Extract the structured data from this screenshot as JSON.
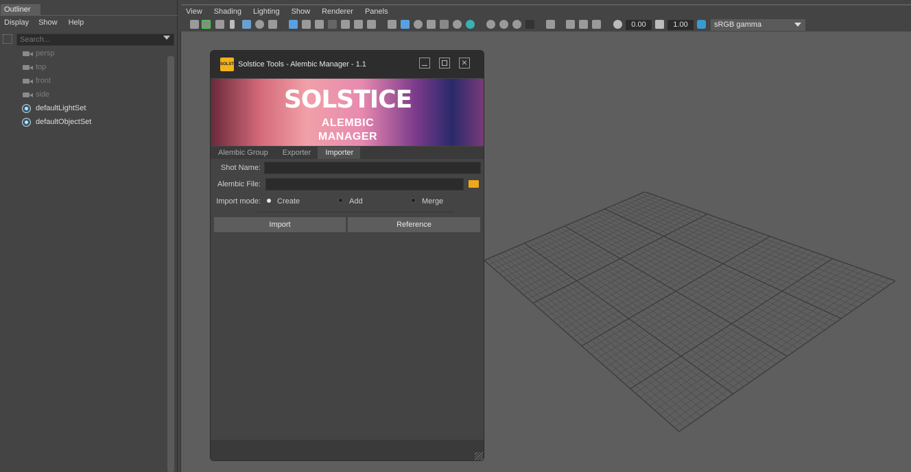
{
  "outliner": {
    "tab_label": "Outliner",
    "menu": [
      "Display",
      "Show",
      "Help"
    ],
    "search_placeholder": "Search...",
    "items": [
      {
        "label": "persp",
        "icon": "camera-icon"
      },
      {
        "label": "top",
        "icon": "camera-icon"
      },
      {
        "label": "front",
        "icon": "camera-icon"
      },
      {
        "label": "side",
        "icon": "camera-icon"
      },
      {
        "label": "defaultLightSet",
        "icon": "set-icon"
      },
      {
        "label": "defaultObjectSet",
        "icon": "set-icon"
      }
    ]
  },
  "viewport": {
    "menu": [
      "View",
      "Shading",
      "Lighting",
      "Show",
      "Renderer",
      "Panels"
    ],
    "exposure": "0.00",
    "gamma": "1.00",
    "color_space": "sRGB gamma"
  },
  "dialog": {
    "title": "Solstice Tools - Alembic Manager - 1.1",
    "logo_text": "SOLSTICE",
    "banner_title": "SOLSTICE",
    "banner_sub1": "ALEMBIC",
    "banner_sub2": "MANAGER",
    "tabs": [
      "Alembic Group",
      "Exporter",
      "Importer"
    ],
    "active_tab": "Importer",
    "shot_name_label": "Shot Name:",
    "shot_name_value": "",
    "alembic_file_label": "Alembic File:",
    "alembic_file_value": "",
    "import_mode_label": "Import mode:",
    "modes": [
      "Create",
      "Add",
      "Merge"
    ],
    "selected_mode": "Create",
    "import_button": "Import",
    "reference_button": "Reference"
  },
  "colors": {
    "accent": "#f2b21b",
    "panel": "#444444",
    "viewport": "#5e5e5e"
  }
}
